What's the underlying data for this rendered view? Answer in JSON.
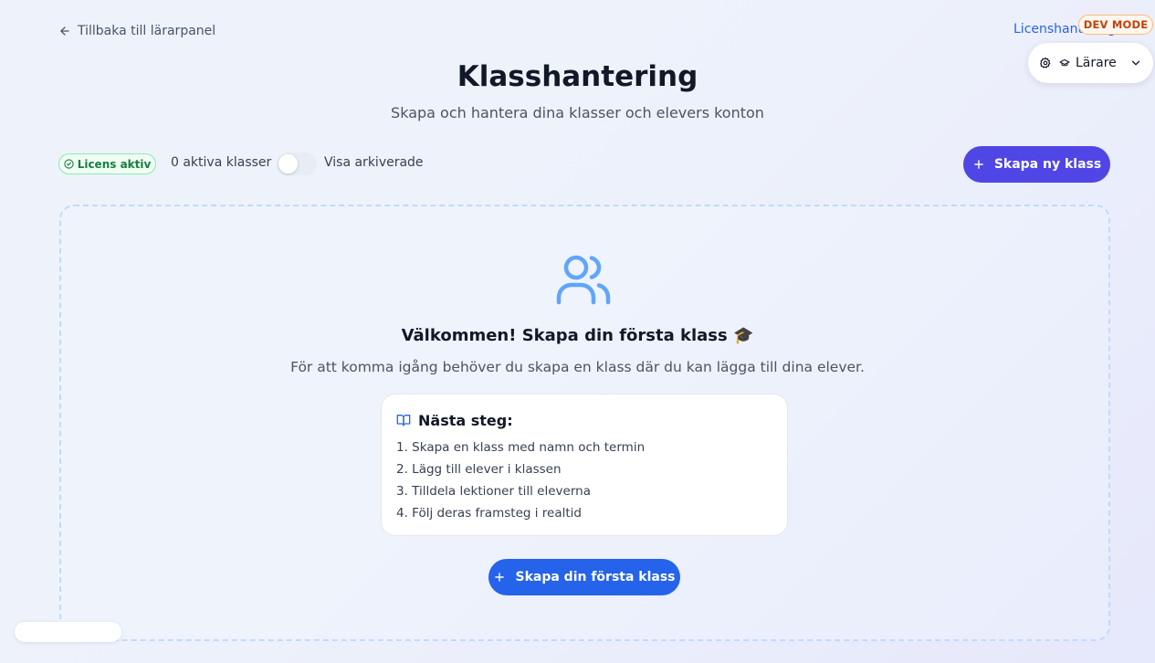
{
  "nav": {
    "back_label": "Tillbaka till lärarpanel",
    "license_link": "Licenshantering",
    "dev_badge": "DEV MODE",
    "role": "Lärare"
  },
  "header": {
    "title": "Klasshantering",
    "subtitle": "Skapa och hantera dina klasser och elevers konton"
  },
  "toolbar": {
    "license_status": "Licens aktiv",
    "active_classes": "0 aktiva klasser",
    "show_archived_label": "Visa arkiverade",
    "show_archived_on": false,
    "create_class_label": "Skapa ny klass"
  },
  "empty_state": {
    "title": "Välkommen! Skapa din första klass 🎓",
    "description": "För att komma igång behöver du skapa en klass där du kan lägga till dina elever.",
    "next_steps_title": "Nästa steg:",
    "steps": [
      "1. Skapa en klass med namn och termin",
      "2. Lägg till elever i klassen",
      "3. Tilldela lektioner till eleverna",
      "4. Följ deras framsteg i realtid"
    ],
    "cta_label": "Skapa din första klass"
  },
  "colors": {
    "primary_indigo": "#4f46e5",
    "primary_blue": "#2563eb",
    "license_green": "#15803d",
    "dev_orange": "#c2410c"
  }
}
